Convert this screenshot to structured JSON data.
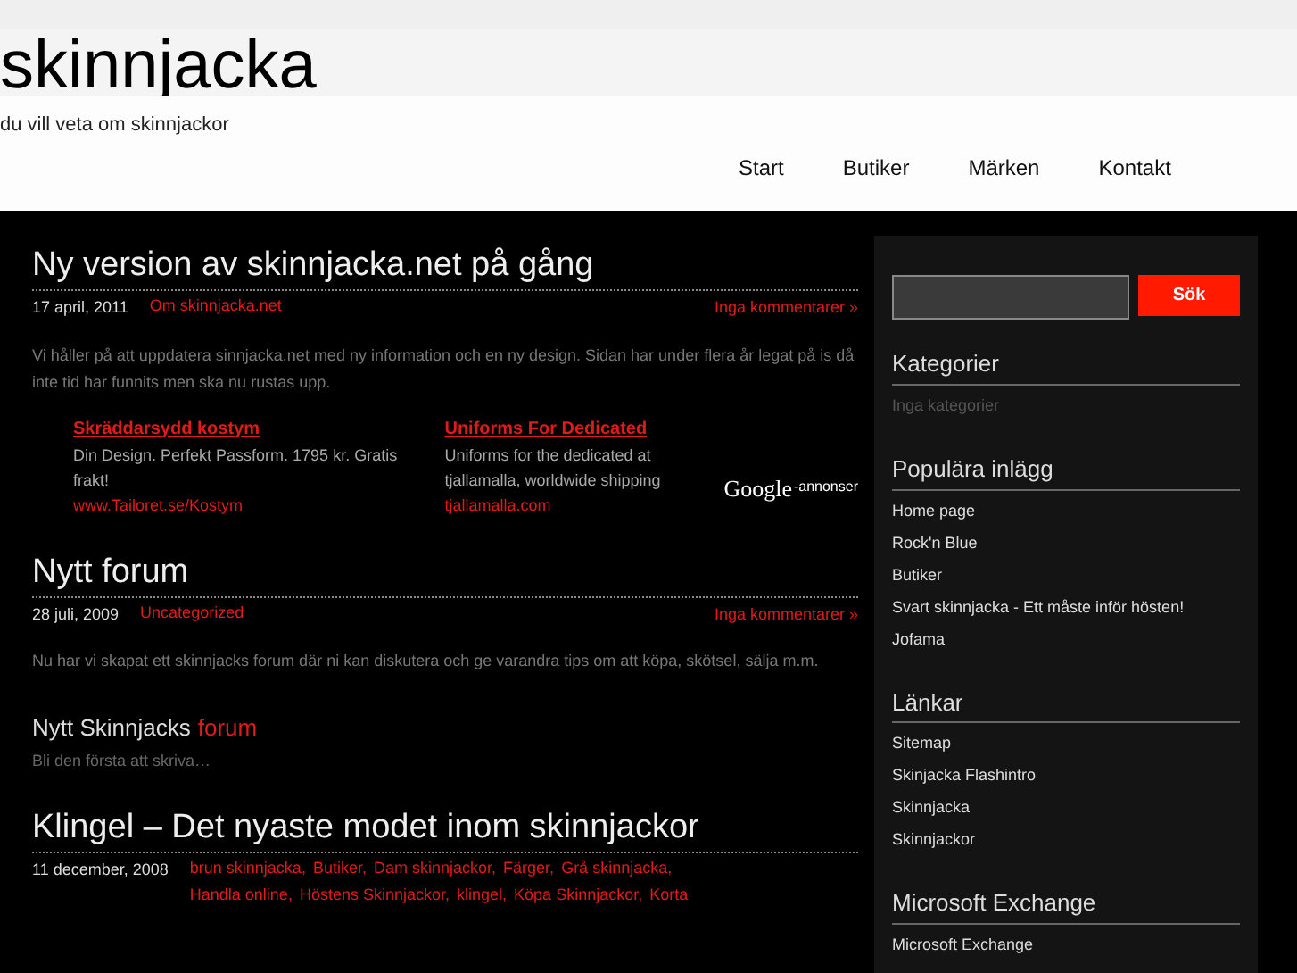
{
  "header": {
    "title": "skinnjacka",
    "tagline": "du vill veta om skinnjackor"
  },
  "nav": [
    {
      "label": "Start"
    },
    {
      "label": "Butiker"
    },
    {
      "label": "Märken"
    },
    {
      "label": "Kontakt"
    }
  ],
  "posts": [
    {
      "title": "Ny version av skinnjacka.net på gång",
      "date": "17 april, 2011",
      "categories": [
        "Om skinnjacka.net"
      ],
      "comments": "Inga kommentarer »",
      "body": "Vi håller på att uppdatera sinnjacka.net med ny information och en ny design. Sidan har under flera år legat på is då inte tid har funnits men ska nu rustas upp.",
      "ads": {
        "items": [
          {
            "title": "Skräddarsydd kostym",
            "text": "Din Design. Perfekt Passform. 1795 kr. Gratis frakt!",
            "url": "www.Tailoret.se/Kostym"
          },
          {
            "title": "Uniforms For Dedicated",
            "text": "Uniforms for the dedicated at tjallamalla, worldwide shipping",
            "url": "tjallamalla.com"
          }
        ],
        "brand": "Google",
        "label": "-annonser"
      }
    },
    {
      "title": "Nytt forum",
      "date": "28 juli, 2009",
      "categories": [
        "Uncategorized"
      ],
      "comments": "Inga kommentarer »",
      "body": "Nu har vi skapat ett skinnjacks forum där ni kan diskutera och ge varandra tips om att köpa, skötsel, sälja m.m.",
      "sub": {
        "title": "Nytt Skinnjacks",
        "link": "forum",
        "text": "Bli den första att skriva…"
      }
    },
    {
      "title": "Klingel – Det nyaste modet inom skinnjackor",
      "date": "11 december, 2008",
      "separator": ",",
      "categories": [
        "brun skinnjacka",
        "Butiker",
        "Dam skinnjackor",
        "Färger",
        "Grå skinnjacka",
        "Handla online",
        "Höstens Skinnjackor",
        "klingel",
        "Köpa Skinnjackor",
        "Korta"
      ]
    }
  ],
  "sidebar": {
    "search_button": "Sök",
    "widgets": [
      {
        "title": "Kategorier",
        "empty": "Inga kategorier"
      },
      {
        "title": "Populära inlägg",
        "links": [
          "Home page",
          "Rock'n Blue",
          "Butiker",
          "Svart skinnjacka - Ett måste inför hösten!",
          "Jofama"
        ]
      },
      {
        "title": "Länkar",
        "links": [
          "Sitemap",
          "Skinjacka Flashintro",
          "Skinnjacka",
          "Skinnjackor"
        ]
      },
      {
        "title": "Microsoft Exchange",
        "links": [
          "Microsoft Exchange"
        ]
      }
    ]
  }
}
